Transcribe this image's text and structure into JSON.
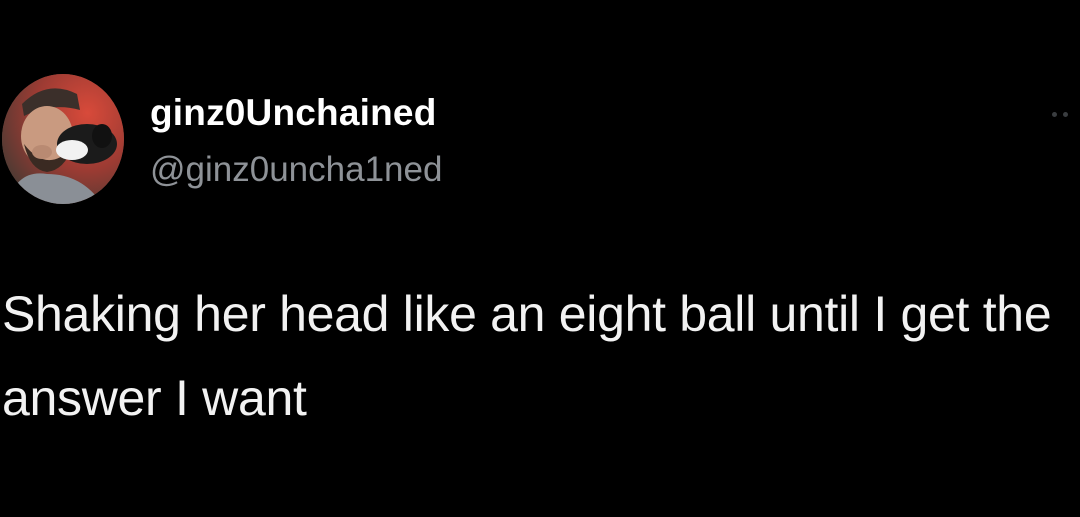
{
  "tweet": {
    "author": {
      "display_name": "ginz0Unchained",
      "handle": "@ginz0uncha1ned",
      "avatar_icon": "user-avatar-photo"
    },
    "more_icon": "more-options-icon",
    "text": "Shaking her head like an eight ball until I get the answer I want"
  },
  "colors": {
    "background": "#000000",
    "text": "#ffffff",
    "handle": "#8e9297"
  }
}
